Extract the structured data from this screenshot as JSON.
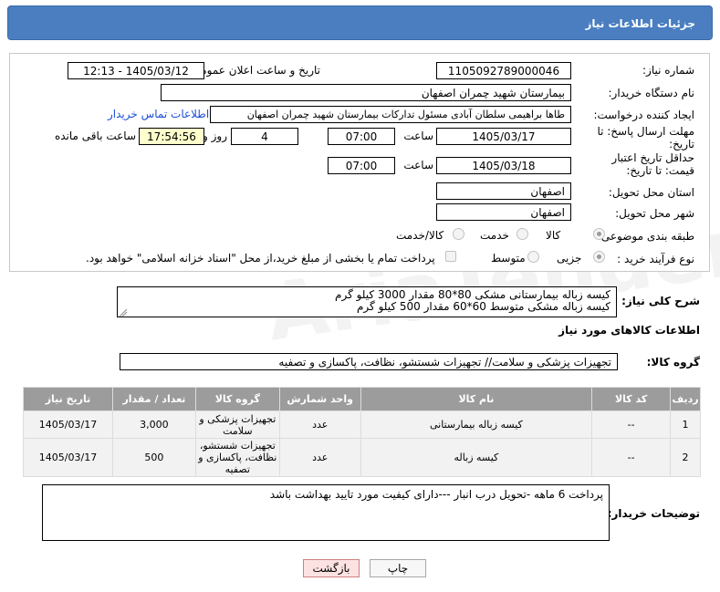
{
  "header": {
    "title": "جزئیات اطلاعات نیاز"
  },
  "form": {
    "need_number_label": "شماره نیاز:",
    "need_number": "1105092789000046",
    "announce_label": "تاریخ و ساعت اعلان عمومی:",
    "announce_value": "1405/03/12 - 12:13",
    "buyer_org_label": "نام دستگاه خریدار:",
    "buyer_org": "بیمارستان شهید چمران اصفهان",
    "creator_label": "ایجاد کننده درخواست:",
    "creator": "طاها براهیمی سلطان آبادی مسئول تدارکات  بیمارستان شهید چمران اصفهان",
    "contact_link": "اطلاعات تماس خریدار",
    "deadline_label": "مهلت ارسال پاسخ: تا تاریخ:",
    "deadline_date": "1405/03/17",
    "time_label": "ساعت",
    "deadline_time": "07:00",
    "days_value": "4",
    "days_label": "روز و",
    "remaining_time": "17:54:56",
    "remaining_label": "ساعت باقی مانده",
    "validity_label": "حداقل تاریخ اعتبار قیمت: تا تاریخ:",
    "validity_date": "1405/03/18",
    "validity_time": "07:00",
    "province_label": "استان محل تحویل:",
    "province": "اصفهان",
    "city_label": "شهر محل تحویل:",
    "city": "اصفهان",
    "category_label": "طبقه بندی موضوعی:",
    "category_options": [
      "کالا",
      "خدمت",
      "کالا/خدمت"
    ],
    "process_label": "نوع فرآیند خرید :",
    "process_options": [
      "جزیی",
      "متوسط"
    ],
    "payment_note": "پرداخت تمام یا بخشی از مبلغ خرید،از محل \"اسناد خزانه اسلامی\" خواهد بود."
  },
  "description": {
    "label": "شرح کلی نیاز:",
    "line1": "کیسه زباله بیمارستانی مشکی 80*80 مقدار 3000 کیلو گرم",
    "line2": "کیسه زباله مشکی متوسط 60*60 مقدار 500 کیلو گرم"
  },
  "goods_section": {
    "title": "اطلاعات کالاهای مورد نیاز",
    "group_label": "گروه کالا:",
    "group_value": "تجهیزات پزشکی و سلامت// تجهیزات شستشو، نظافت، پاکسازی و تصفیه"
  },
  "table": {
    "headers": [
      "ردیف",
      "کد کالا",
      "نام کالا",
      "واحد شمارش",
      "گروه کالا",
      "تعداد / مقدار",
      "تاریخ نیاز"
    ],
    "rows": [
      {
        "row": "1",
        "code": "--",
        "name": "کیسه زباله بیمارستانی",
        "unit": "عدد",
        "group": "تجهیزات پزشکی و سلامت",
        "qty": "3,000",
        "date": "1405/03/17"
      },
      {
        "row": "2",
        "code": "--",
        "name": "کیسه زباله",
        "unit": "عدد",
        "group": "تجهیزات شستشو، نظافت، پاکسازی و تصفیه",
        "qty": "500",
        "date": "1405/03/17"
      }
    ]
  },
  "notes": {
    "label": "توضیحات خریدار:",
    "text": "پرداخت 6 ماهه -تحویل درب انبار ---دارای کیفیت مورد تایید بهداشت باشد"
  },
  "buttons": {
    "print": "چاپ",
    "back": "بازگشت"
  },
  "watermark": "AriaTender.net"
}
